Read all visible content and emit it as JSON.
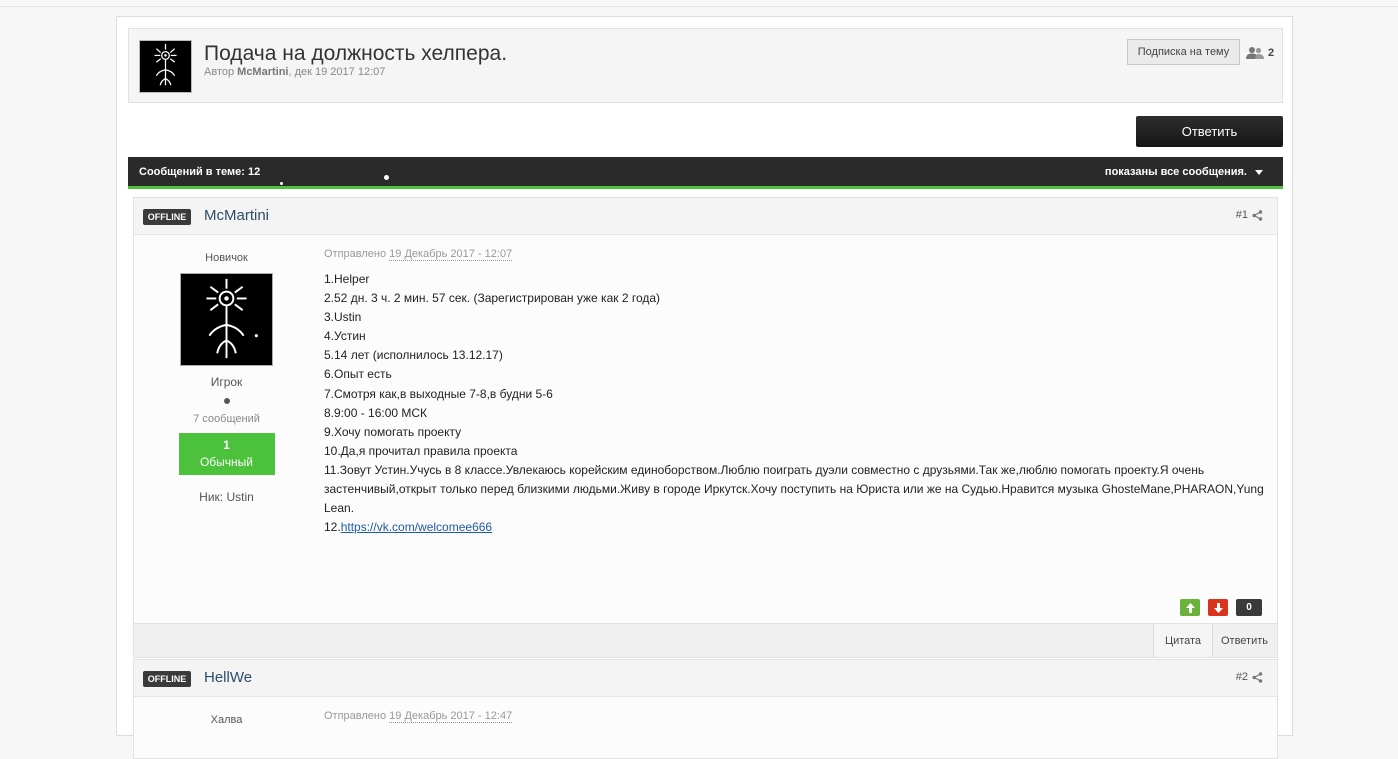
{
  "topic": {
    "title": "Подача на должность хелпера.",
    "byline_prefix": "Автор",
    "author": "McMartini",
    "date": ", дек 19 2017 12:07",
    "follow_label": "Подписка на тему",
    "followers_count": "2"
  },
  "reply_button": "Ответить",
  "count_bar": {
    "messages": "Сообщений в теме: 12",
    "filter": "показаны все сообщения."
  },
  "posts": [
    {
      "status": "OFFLINE",
      "author": "McMartini",
      "number": "#1",
      "member_title": "Новичок",
      "group": "Игрок",
      "post_count": "7 сообщений",
      "reputation_value": "1",
      "reputation_label": "Обычный",
      "nick": "Ник: Ustin",
      "posted_prefix": "Отправлено",
      "posted_date": "19 Декабрь 2017 - 12:07",
      "lines": [
        "1.Helper",
        "2.52 дн. 3 ч. 2 мин. 57 сек. (Зарегистрирован уже как 2 года)",
        "3.Ustin",
        "4.Устин",
        "5.14 лет (исполнилось 13.12.17)",
        "6.Опыт есть",
        "7.Смотря как,в выходные 7-8,в будни 5-6",
        "8.9:00 - 16:00 МСК",
        "9.Хочу помогать проекту",
        "10.Да,я прочитал правила проекта",
        "11.Зовут Устин.Учусь в 8 классе.Увлекаюсь корейским единоборством.Люблю поиграть дуэли совместно с друзьями.Так же,люблю помогать проекту.Я очень застенчивый,открыт только перед близкими людьми.Живу в городе Иркутск.Хочу поступить на Юриста или же на Судью.Нравится музыка GhosteMane,PHARAON,Yung Lean."
      ],
      "link_prefix": "12.",
      "link": "https://vk.com/welcomee666",
      "rep_count": "0",
      "quote_label": "Цитата",
      "reply_label": "Ответить"
    },
    {
      "status": "OFFLINE",
      "author": "HellWe",
      "number": "#2",
      "member_title": "Халва",
      "posted_prefix": "Отправлено",
      "posted_date": "19 Декабрь 2017 - 12:47"
    }
  ],
  "colors": {
    "accent_green": "#4ec23a",
    "dark_bar": "#2a2a2a",
    "link": "#1f5aa6"
  },
  "icons": [
    "members-icon",
    "share-icon",
    "chevron-down-icon",
    "vote-up-icon",
    "vote-down-icon"
  ]
}
